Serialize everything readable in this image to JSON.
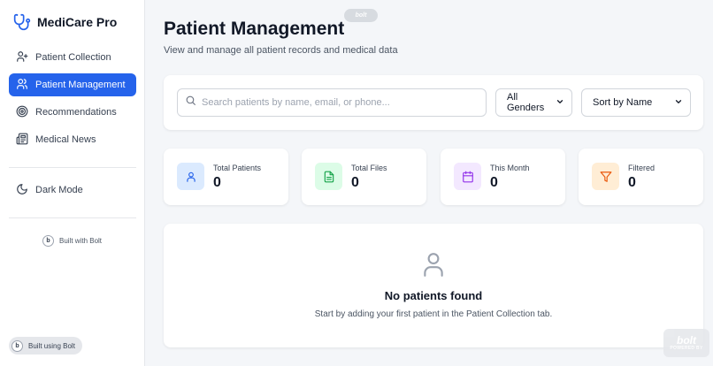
{
  "app": {
    "name": "MediCare Pro"
  },
  "sidebar": {
    "items": [
      {
        "label": "Patient Collection",
        "icon": "user-plus-icon",
        "active": false
      },
      {
        "label": "Patient Management",
        "icon": "users-icon",
        "active": true
      },
      {
        "label": "Recommendations",
        "icon": "target-icon",
        "active": false
      },
      {
        "label": "Medical News",
        "icon": "newspaper-icon",
        "active": false
      }
    ],
    "dark_mode_label": "Dark Mode",
    "built_with_label": "Built with Bolt",
    "built_using_label": "Built using Bolt",
    "bolt_letter": "b"
  },
  "header": {
    "title": "Patient Management",
    "subtitle": "View and manage all patient records and medical data",
    "badge": "bolt"
  },
  "filters": {
    "search_placeholder": "Search patients by name, email, or phone...",
    "search_value": "",
    "gender_selected": "All Genders",
    "sort_selected": "Sort by Name"
  },
  "stats": [
    {
      "label": "Total Patients",
      "value": "0",
      "icon": "user-icon",
      "bg": "#dbeafe",
      "fg": "#2563eb"
    },
    {
      "label": "Total Files",
      "value": "0",
      "icon": "file-text-icon",
      "bg": "#dcfce7",
      "fg": "#16a34a"
    },
    {
      "label": "This Month",
      "value": "0",
      "icon": "calendar-icon",
      "bg": "#f3e8ff",
      "fg": "#9333ea"
    },
    {
      "label": "Filtered",
      "value": "0",
      "icon": "filter-icon",
      "bg": "#ffedd5",
      "fg": "#ea580c"
    }
  ],
  "empty_state": {
    "title": "No patients found",
    "text": "Start by adding your first patient in the Patient Collection tab."
  },
  "watermark": {
    "word": "bolt",
    "sub": "POWERED BY"
  },
  "colors": {
    "accent": "#2563eb",
    "background": "#f4f6f9"
  }
}
